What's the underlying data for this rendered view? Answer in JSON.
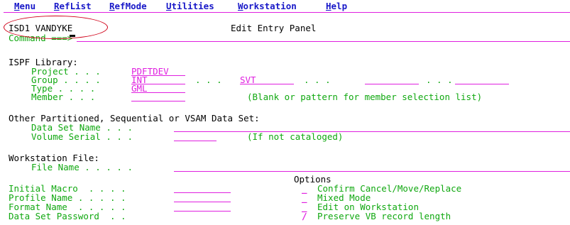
{
  "menu": {
    "items": [
      {
        "first": "M",
        "rest": "enu"
      },
      {
        "first": "R",
        "rest": "efList"
      },
      {
        "first": "R",
        "rest": "efMode"
      },
      {
        "first": "U",
        "rest": "tilities"
      },
      {
        "first": "W",
        "rest": "orkstation"
      },
      {
        "first": "H",
        "rest": "elp"
      }
    ]
  },
  "header": {
    "system_id": "ISD1 VANDYKE",
    "panel_title": "Edit Entry Panel",
    "command_label": "Command ===>"
  },
  "ispf_library": {
    "heading": "ISPF Library:",
    "project_label": "Project . . .",
    "project_value": "PDFTDEV",
    "group_label": "Group . . . .",
    "group_value1": "INT",
    "group_dots": ". . .",
    "group_value2": "SVT",
    "group_dots2": ". . .",
    "group_dots3": ". . .",
    "type_label": "Type . . . .",
    "type_value": "GML",
    "member_label": "Member . . .",
    "member_hint": "(Blank or pattern for member selection list)"
  },
  "other_dataset": {
    "heading": "Other Partitioned, Sequential or VSAM Data Set:",
    "dsn_label": "Data Set Name . . .",
    "volser_label": "Volume Serial . . .",
    "volser_hint": "(If not cataloged)"
  },
  "workstation_file": {
    "heading": "Workstation File:",
    "file_name_label": "File Name . . . . ."
  },
  "options": {
    "heading": "Options",
    "initial_macro_label": "Initial Macro  . . . .",
    "profile_name_label": "Profile Name . . . . .",
    "format_name_label": "Format Name  . . . . .",
    "password_label": "Data Set Password  . .",
    "checkboxes": [
      {
        "mark": "_",
        "label": "Confirm Cancel/Move/Replace"
      },
      {
        "mark": "_",
        "label": "Mixed Mode"
      },
      {
        "mark": "_",
        "label": "Edit on Workstation"
      },
      {
        "mark": "/",
        "label": "Preserve VB record length"
      }
    ]
  }
}
